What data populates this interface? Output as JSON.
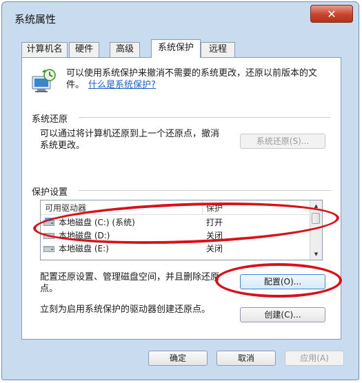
{
  "window": {
    "title": "系统属性",
    "close_glyph": "✕"
  },
  "tabs": [
    {
      "label": "计算机名"
    },
    {
      "label": "硬件"
    },
    {
      "label": "高级"
    },
    {
      "label": "系统保护"
    },
    {
      "label": "远程"
    }
  ],
  "intro": {
    "text": "可以使用系统保护来撤消不需要的系统更改，还原以前版本的文件。",
    "link": "什么是系统保护?",
    "icon": "system-protection-icon"
  },
  "restore": {
    "label": "系统还原",
    "description": "可以通过将计算机还原到上一个还原点，撤消系统更改。",
    "button": "系统还原(S)..."
  },
  "protection": {
    "label": "保护设置",
    "columns": [
      "可用驱动器",
      "保护"
    ],
    "drives": [
      {
        "name": "本地磁盘 (C:) (系统)",
        "status": "打开"
      },
      {
        "name": "本地磁盘 (D:)",
        "status": "关闭"
      },
      {
        "name": "本地磁盘 (E:)",
        "status": "关闭"
      }
    ]
  },
  "configure": {
    "description": "配置还原设置、管理磁盘空间，并且删除还原点。",
    "button": "配置(O)..."
  },
  "create": {
    "description": "立刻为启用系统保护的驱动器创建还原点。",
    "button": "创建(C)..."
  },
  "footer": {
    "ok": "确定",
    "cancel": "取消",
    "apply": "应用(A)"
  },
  "colors": {
    "annotation": "#d8121a",
    "link": "#1d5fbf",
    "window_frame": "#c9dcef"
  }
}
